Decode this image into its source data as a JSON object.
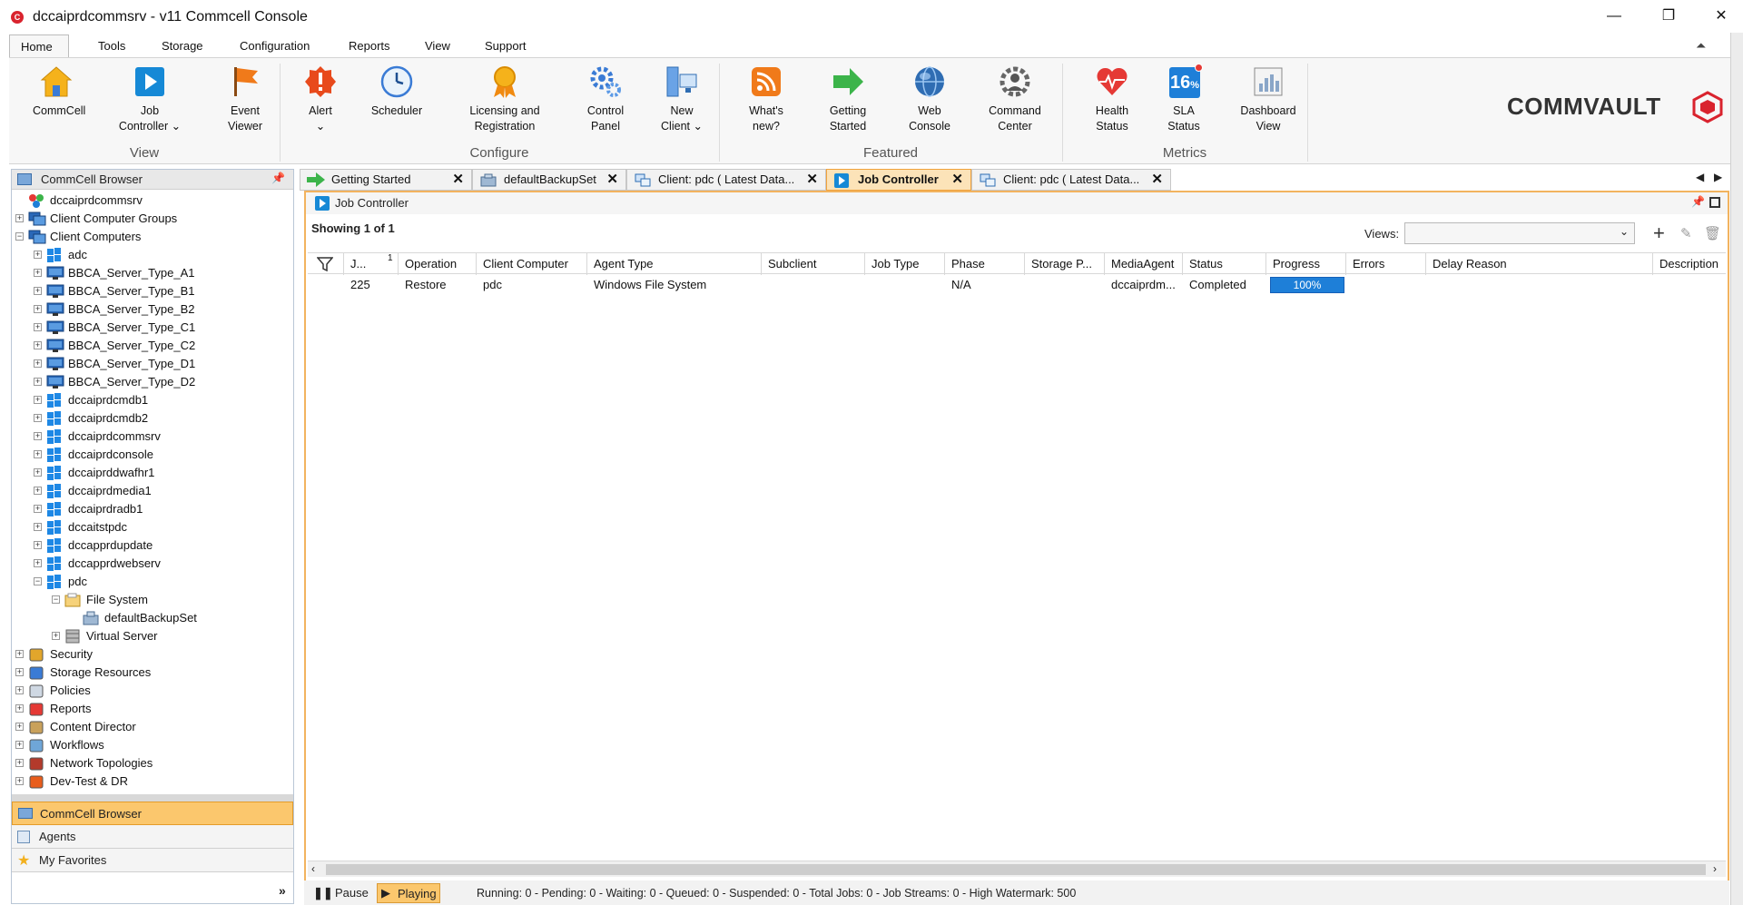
{
  "window": {
    "title": "dccaiprdcommsrv - v11 Commcell Console",
    "minimize": "—",
    "restore": "❐",
    "close": "✕"
  },
  "menu": {
    "tabs": [
      "Home",
      "Tools",
      "Storage",
      "Configuration",
      "Reports",
      "View",
      "Support"
    ],
    "active": "Home"
  },
  "ribbon": {
    "groups": [
      "View",
      "Configure",
      "Featured",
      "Metrics"
    ],
    "buttons": {
      "commcell": "CommCell",
      "job_controller_1": "Job",
      "job_controller_2": "Controller",
      "event_viewer_1": "Event",
      "event_viewer_2": "Viewer",
      "alert": "Alert",
      "scheduler": "Scheduler",
      "licensing_1": "Licensing and",
      "licensing_2": "Registration",
      "control_panel_1": "Control",
      "control_panel_2": "Panel",
      "new_client_1": "New",
      "new_client_2": "Client",
      "whats_new_1": "What's",
      "whats_new_2": "new?",
      "getting_started_1": "Getting",
      "getting_started_2": "Started",
      "web_console_1": "Web",
      "web_console_2": "Console",
      "command_center_1": "Command",
      "command_center_2": "Center",
      "health_status_1": "Health",
      "health_status_2": "Status",
      "sla_status_1": "SLA",
      "sla_status_2": "Status",
      "sla_value": "16",
      "dashboard_1": "Dashboard",
      "dashboard_2": "View"
    },
    "brand": "COMMVAULT",
    "brand_color": "#d9232e"
  },
  "left_panel": {
    "header": "CommCell Browser",
    "tree": {
      "root": "dccaiprdcommsrv",
      "client_computer_groups": "Client Computer Groups",
      "client_computers": "Client Computers",
      "clients": [
        "adc",
        "BBCA_Server_Type_A1",
        "BBCA_Server_Type_B1",
        "BBCA_Server_Type_B2",
        "BBCA_Server_Type_C1",
        "BBCA_Server_Type_C2",
        "BBCA_Server_Type_D1",
        "BBCA_Server_Type_D2",
        "dccaiprdcmdb1",
        "dccaiprdcmdb2",
        "dccaiprdcommsrv",
        "dccaiprdconsole",
        "dccaiprddwafhr1",
        "dccaiprdmedia1",
        "dccaiprdradb1",
        "dccaitstpdc",
        "dccapprdupdate",
        "dccapprdwebserv",
        "pdc"
      ],
      "file_system": "File System",
      "default_backup_set": "defaultBackupSet",
      "virtual_server": "Virtual Server",
      "others": [
        "Security",
        "Storage Resources",
        "Policies",
        "Reports",
        "Content Director",
        "Workflows",
        "Network Topologies",
        "Dev-Test & DR"
      ]
    },
    "bottom_tabs": [
      "CommCell Browser",
      "Agents",
      "My Favorites"
    ]
  },
  "doc_tabs": [
    {
      "label": "Getting Started",
      "active": false
    },
    {
      "label": "defaultBackupSet",
      "active": false
    },
    {
      "label": "Client: pdc ( Latest Data...",
      "active": false
    },
    {
      "label": "Job Controller",
      "active": true
    },
    {
      "label": "Client: pdc ( Latest Data...",
      "active": false
    }
  ],
  "job_controller": {
    "title": "Job Controller",
    "showing": "Showing 1 of 1",
    "views_label": "Views:",
    "sort_indicator": "1",
    "columns": [
      "J...",
      "Operation",
      "Client Computer",
      "Agent Type",
      "Subclient",
      "Job Type",
      "Phase",
      "Storage P...",
      "MediaAgent",
      "Status",
      "Progress",
      "Errors",
      "Delay Reason",
      "Description"
    ],
    "rows": [
      {
        "job_id": "225",
        "operation": "Restore",
        "client": "pdc",
        "agent_type": "Windows File System",
        "subclient": "",
        "job_type": "",
        "phase": "N/A",
        "storage_policy": "",
        "media_agent": "dccaiprdm...",
        "status": "Completed",
        "progress_label": "100%",
        "progress": 1.0,
        "errors": "",
        "delay_reason": "",
        "description": ""
      }
    ]
  },
  "status_bar": {
    "pause": "Pause",
    "playing": "Playing",
    "summary": "Running: 0 - Pending: 0 - Waiting: 0 - Queued: 0 - Suspended: 0 - Total Jobs: 0 - Job Streams: 0 - High Watermark: 500"
  }
}
